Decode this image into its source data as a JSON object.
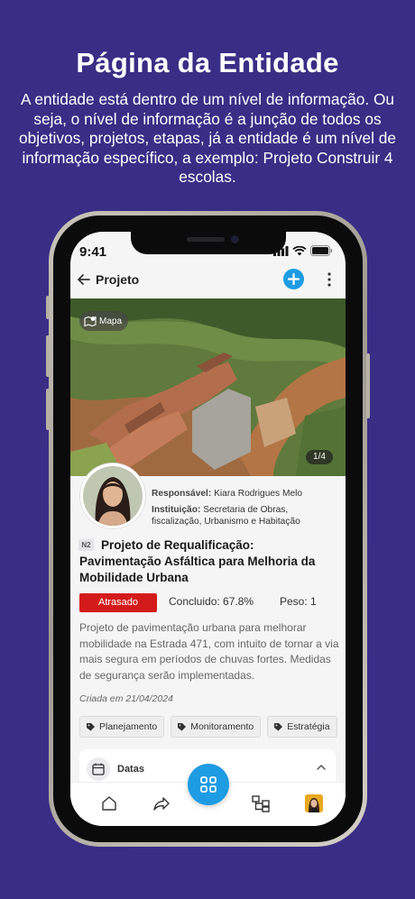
{
  "hero": {
    "title": "Página da Entidade",
    "description": "A entidade está dentro de um nível de informação. Ou seja, o nível de informação é a junção de todos os objetivos, projetos, etapas, já a entidade é um nível de informação específico, a exemplo: Projeto Construir 4 escolas."
  },
  "status_bar": {
    "time": "9:41"
  },
  "app_bar": {
    "title": "Projeto"
  },
  "photo": {
    "map_label": "Mapa",
    "counter": "1/4"
  },
  "project": {
    "responsible_label": "Responsável:",
    "responsible": "Kiara Rodrigues Melo",
    "institution_label": "Instituição:",
    "institution": "Secretaria de Obras, fiscalização, Urbanismo e Habitação",
    "level": "N2",
    "title": "Projeto de Requalificação: Pavimentação Asfáltica para Melhoria da Mobilidade Urbana",
    "status": "Atrasado",
    "completion": "Concluido: 67.8%",
    "weight": "Peso: 1",
    "description": "Projeto de pavimentação urbana para melhorar mobilidade na Estrada 471, com intuito de tornar a via mais segura em períodos de chuvas fortes. Medidas de segurança serão implementadas.",
    "created": "Criada em 21/04/2024",
    "tags": [
      "Planejamento",
      "Monitoramento",
      "Estratégia"
    ]
  },
  "sections": {
    "dates_label": "Datas"
  },
  "colors": {
    "background": "#3a2d86",
    "accent": "#1d9be3",
    "status_late": "#d41b1b"
  }
}
